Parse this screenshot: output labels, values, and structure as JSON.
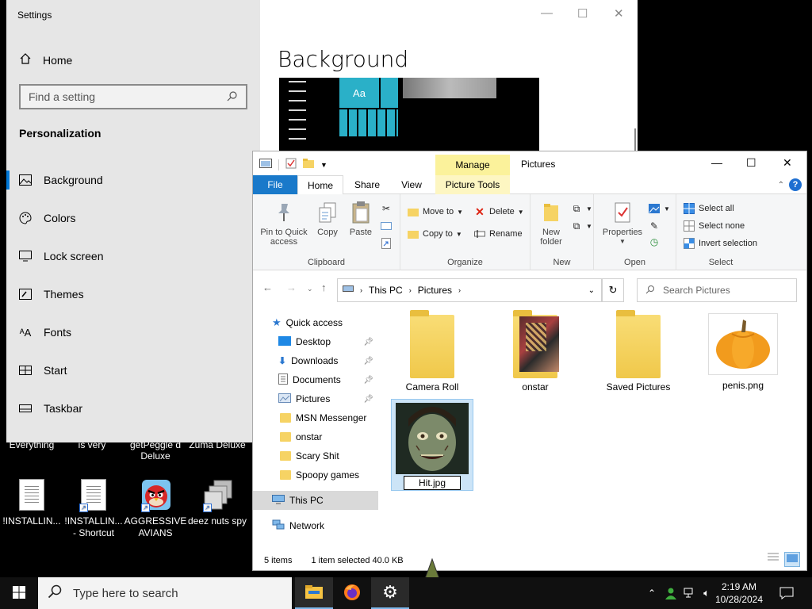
{
  "desktop": {
    "background_labels": [
      "Everything",
      "is very",
      "getPeggle d",
      "Zuma Deluxe",
      "Deluxe"
    ],
    "icons": [
      {
        "label": "!INSTALLIN...",
        "icon": "text-document-icon"
      },
      {
        "label": "!INSTALLIN... - Shortcut",
        "icon": "text-document-shortcut-icon"
      },
      {
        "label": "AGGRESSIVE AVIANS",
        "icon": "angry-bird-icon"
      },
      {
        "label": "deez nuts spy",
        "icon": "stacked-windows-icon"
      }
    ]
  },
  "settings": {
    "window_title": "Settings",
    "home": "Home",
    "search_placeholder": "Find a setting",
    "section": "Personalization",
    "items": [
      {
        "label": "Background",
        "icon": "picture-icon"
      },
      {
        "label": "Colors",
        "icon": "palette-icon"
      },
      {
        "label": "Lock screen",
        "icon": "monitor-icon"
      },
      {
        "label": "Themes",
        "icon": "brush-icon"
      },
      {
        "label": "Fonts",
        "icon": "font-icon"
      },
      {
        "label": "Start",
        "icon": "start-grid-icon"
      },
      {
        "label": "Taskbar",
        "icon": "taskbar-icon"
      }
    ],
    "active_item": "Background",
    "page_title": "Background",
    "preview_tile_text": "Aa",
    "accent": "#0078d7"
  },
  "explorer": {
    "title": "Pictures",
    "contextual_tab": "Manage",
    "tabs": [
      "File",
      "Home",
      "Share",
      "View",
      "Picture Tools"
    ],
    "ribbon": {
      "clipboard": {
        "label": "Clipboard",
        "pin": "Pin to Quick access",
        "copy": "Copy",
        "paste": "Paste"
      },
      "organize": {
        "label": "Organize",
        "move_to": "Move to",
        "copy_to": "Copy to",
        "delete": "Delete",
        "rename": "Rename"
      },
      "new": {
        "label": "New",
        "new_folder": "New folder"
      },
      "open": {
        "label": "Open",
        "properties": "Properties"
      },
      "select": {
        "label": "Select",
        "select_all": "Select all",
        "select_none": "Select none",
        "invert": "Invert selection"
      }
    },
    "address": [
      "This PC",
      "Pictures"
    ],
    "search_placeholder": "Search Pictures",
    "nav": {
      "quick_access": "Quick access",
      "pinned": [
        {
          "label": "Desktop",
          "icon": "desktop-folder-icon"
        },
        {
          "label": "Downloads",
          "icon": "download-arrow-icon"
        },
        {
          "label": "Documents",
          "icon": "documents-icon"
        },
        {
          "label": "Pictures",
          "icon": "pictures-folder-icon"
        }
      ],
      "folders": [
        "MSN Messenger",
        "onstar",
        "Scary Shit",
        "Spoopy games"
      ],
      "this_pc": "This PC",
      "network": "Network"
    },
    "files": [
      {
        "name": "Camera Roll",
        "type": "folder"
      },
      {
        "name": "onstar",
        "type": "folder-with-images"
      },
      {
        "name": "Saved Pictures",
        "type": "folder"
      },
      {
        "name": "penis.png",
        "type": "image-pumpkin"
      },
      {
        "name": "Hit.jpg",
        "type": "image-scary-face",
        "selected": true
      }
    ],
    "status": {
      "items": "5 items",
      "selected": "1 item selected  40.0 KB"
    }
  },
  "taskbar": {
    "search_placeholder": "Type here to search",
    "apps": [
      "file-explorer-icon",
      "firefox-icon",
      "settings-gear-icon"
    ],
    "time": "2:19 AM",
    "date": "10/28/2024"
  }
}
